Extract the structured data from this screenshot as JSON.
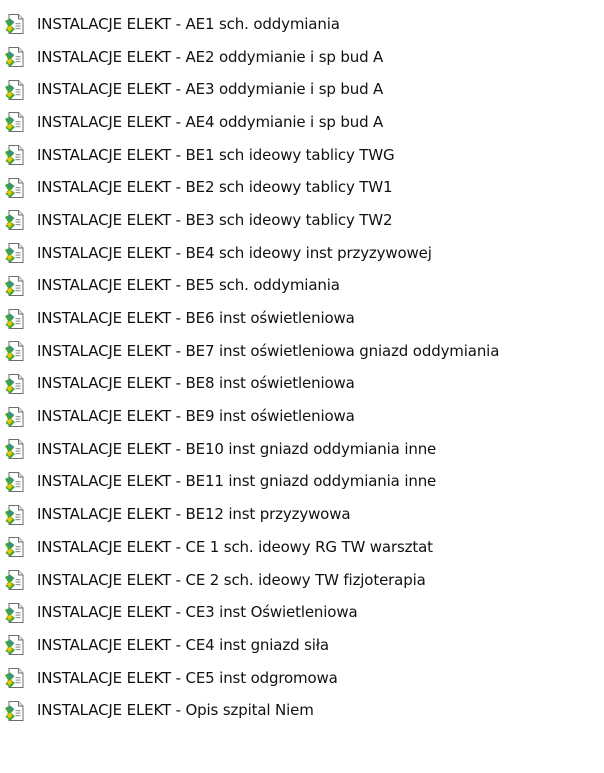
{
  "files": [
    {
      "name": "INSTALACJE ELEKT - AE1 sch. oddymiania",
      "icon": "pdf-file-icon"
    },
    {
      "name": "INSTALACJE ELEKT - AE2 oddymianie i sp bud A",
      "icon": "pdf-file-icon"
    },
    {
      "name": "INSTALACJE ELEKT - AE3 oddymianie i sp bud A",
      "icon": "pdf-file-icon"
    },
    {
      "name": "INSTALACJE ELEKT - AE4 oddymianie i sp bud A",
      "icon": "pdf-file-icon"
    },
    {
      "name": "INSTALACJE ELEKT - BE1 sch ideowy tablicy TWG",
      "icon": "pdf-file-icon"
    },
    {
      "name": "INSTALACJE ELEKT - BE2 sch ideowy tablicy TW1",
      "icon": "pdf-file-icon"
    },
    {
      "name": "INSTALACJE ELEKT - BE3 sch ideowy tablicy TW2",
      "icon": "pdf-file-icon"
    },
    {
      "name": "INSTALACJE ELEKT - BE4 sch ideowy inst przyzywowej",
      "icon": "pdf-file-icon"
    },
    {
      "name": "INSTALACJE ELEKT - BE5 sch. oddymiania",
      "icon": "pdf-file-icon"
    },
    {
      "name": "INSTALACJE ELEKT - BE6 inst oświetleniowa",
      "icon": "pdf-file-icon"
    },
    {
      "name": "INSTALACJE ELEKT - BE7 inst oświetleniowa gniazd oddymiania",
      "icon": "pdf-file-icon"
    },
    {
      "name": "INSTALACJE ELEKT - BE8 inst oświetleniowa",
      "icon": "pdf-file-icon"
    },
    {
      "name": "INSTALACJE ELEKT - BE9 inst oświetleniowa",
      "icon": "pdf-file-icon"
    },
    {
      "name": "INSTALACJE ELEKT - BE10 inst gniazd oddymiania inne",
      "icon": "pdf-file-icon"
    },
    {
      "name": "INSTALACJE ELEKT - BE11 inst gniazd oddymiania inne",
      "icon": "pdf-file-icon"
    },
    {
      "name": "INSTALACJE ELEKT - BE12 inst przyzywowa",
      "icon": "pdf-file-icon"
    },
    {
      "name": "INSTALACJE ELEKT - CE 1 sch. ideowy RG TW warsztat",
      "icon": "pdf-file-icon"
    },
    {
      "name": "INSTALACJE ELEKT - CE 2 sch. ideowy  TW  fizjoterapia",
      "icon": "pdf-file-icon"
    },
    {
      "name": "INSTALACJE ELEKT - CE3 inst Oświetleniowa",
      "icon": "pdf-file-icon"
    },
    {
      "name": "INSTALACJE ELEKT - CE4 inst gniazd siła",
      "icon": "pdf-file-icon"
    },
    {
      "name": "INSTALACJE ELEKT - CE5 inst odgromowa",
      "icon": "pdf-file-icon"
    },
    {
      "name": "INSTALACJE ELEKT - Opis szpital Niem",
      "icon": "pdf-file-icon"
    }
  ],
  "colors": {
    "background": "#ffffff",
    "text": "#111111",
    "icon_page": "#ffffff",
    "icon_border": "#6d6d6d",
    "icon_green": "#3fa535",
    "icon_yellow": "#f2c200",
    "icon_blue": "#3b7fd6"
  }
}
